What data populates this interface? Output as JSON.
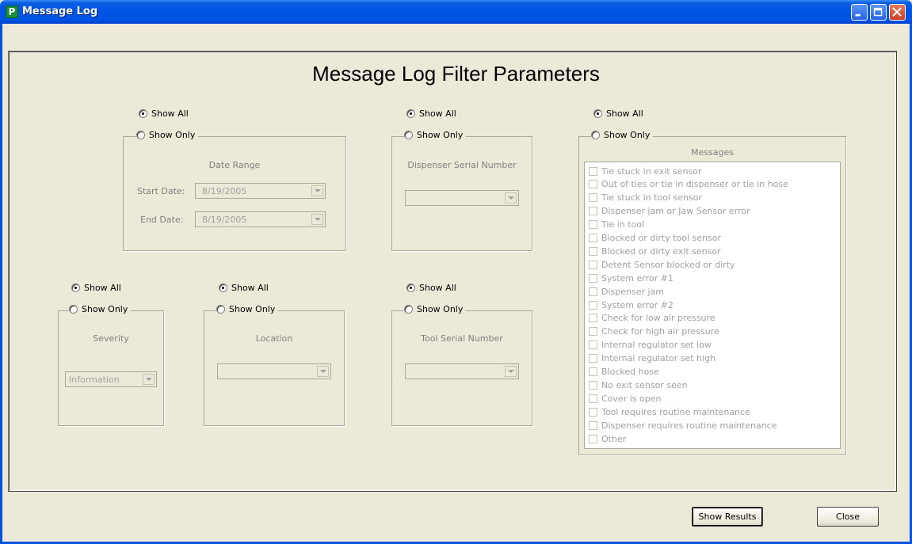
{
  "window": {
    "title": "Message Log",
    "app_icon_glyph": "P",
    "accent": "#0054e3"
  },
  "page_title": "Message Log Filter Parameters",
  "filters": {
    "date": {
      "show_all": "Show All",
      "show_only": "Show Only",
      "selected": "show_all",
      "legend": "Date Range",
      "start_label": "Start Date:",
      "start_value": "8/19/2005",
      "end_label": "End Date:",
      "end_value": "8/19/2005"
    },
    "dispenser": {
      "show_all": "Show All",
      "show_only": "Show Only",
      "selected": "show_all",
      "legend": "Dispenser Serial Number",
      "value": ""
    },
    "messages": {
      "show_all": "Show All",
      "show_only": "Show Only",
      "selected": "show_all",
      "legend": "Messages",
      "items": [
        "Tie stuck in exit sensor",
        "Out of ties or tie in dispenser or tie in hose",
        "Tie stuck in tool sensor",
        "Dispenser jam or Jaw Sensor error",
        "Tie in tool",
        "Blocked or dirty tool sensor",
        "Blocked or dirty exit sensor",
        "Detent Sensor blocked or dirty",
        "System error #1",
        "Dispenser jam",
        "System error #2",
        "Check for low air pressure",
        "Check for high air pressure",
        "Internal regulator set low",
        "Internal regulator set high",
        "Blocked hose",
        "No exit sensor seen",
        "Cover is open",
        "Tool requires routine maintenance",
        "Dispenser requires routine maintenance",
        "Other"
      ]
    },
    "severity": {
      "show_all": "Show All",
      "show_only": "Show Only",
      "selected": "show_all",
      "legend": "Severity",
      "value": "Information"
    },
    "location": {
      "show_all": "Show All",
      "show_only": "Show Only",
      "selected": "show_all",
      "legend": "Location",
      "value": ""
    },
    "tool": {
      "show_all": "Show All",
      "show_only": "Show Only",
      "selected": "show_all",
      "legend": "Tool Serial Number",
      "value": ""
    }
  },
  "buttons": {
    "show_results": "Show Results",
    "close": "Close"
  }
}
